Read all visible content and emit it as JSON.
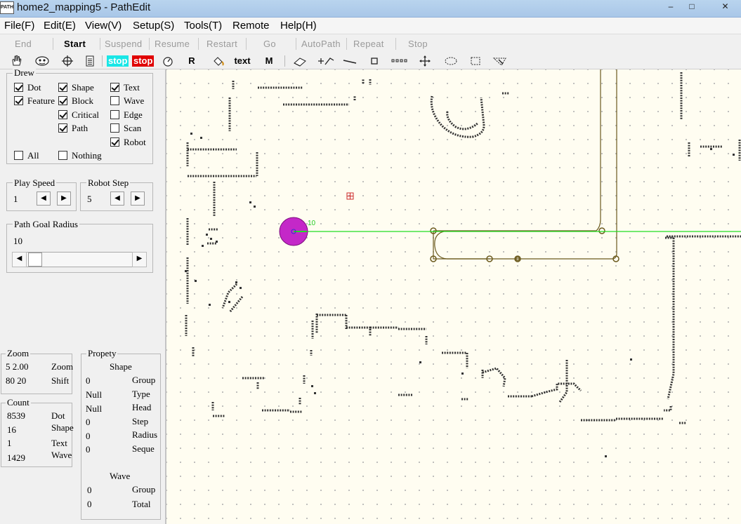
{
  "window": {
    "icon_text": "PATH",
    "title": "home2_mapping5 - PathEdit",
    "minimize": "–",
    "maximize": "□",
    "close": "✕"
  },
  "menu": {
    "items": [
      "File(F)",
      "Edit(E)",
      "View(V)",
      "Setup(S)",
      "Tools(T)",
      "Remote",
      "Help(H)"
    ]
  },
  "actions": {
    "items": [
      "End",
      "Start",
      "Suspend",
      "Resume",
      "Restart",
      "Go",
      "AutoPath",
      "Repeat",
      "Stop"
    ],
    "active": "Start"
  },
  "toolbar": {
    "icons": [
      "hand-icon",
      "eye-icon",
      "crosshair-icon",
      "document-icon"
    ],
    "stop_cyan": "stop",
    "stop_red": "stop",
    "r_label": "R",
    "text_label": "text",
    "m_label": "M",
    "tools": [
      "gauge-icon",
      "paint-icon",
      "eraser-icon",
      "add-point-icon",
      "line-icon",
      "square-icon",
      "dots-icon",
      "move-icon",
      "ellipse-icon",
      "select-rect-icon",
      "pointer-icon"
    ]
  },
  "drew": {
    "label": "Drew",
    "checks": [
      {
        "label": "Dot",
        "checked": true
      },
      {
        "label": "Feature",
        "checked": true
      },
      {
        "label": "Shape",
        "checked": true
      },
      {
        "label": "Block",
        "checked": true
      },
      {
        "label": "Critical",
        "checked": true
      },
      {
        "label": "Path",
        "checked": true
      },
      {
        "label": "Text",
        "checked": true
      },
      {
        "label": "Wave",
        "checked": false
      },
      {
        "label": "Edge",
        "checked": false
      },
      {
        "label": "Scan",
        "checked": false
      },
      {
        "label": "Robot",
        "checked": true
      },
      {
        "label": "All",
        "checked": false
      },
      {
        "label": "Nothing",
        "checked": false
      }
    ]
  },
  "play_speed": {
    "label": "Play Speed",
    "value": "1"
  },
  "robot_step": {
    "label": "Robot Step",
    "value": "5"
  },
  "path_goal_radius": {
    "label": "Path Goal Radius",
    "value": "10"
  },
  "zoom": {
    "label": "Zoom",
    "row1_value": "5 2.00",
    "row1_label": "Zoom",
    "row2_value": "80 20",
    "row2_label": "Shift"
  },
  "count": {
    "label": "Count",
    "rows": [
      {
        "value": "8539",
        "label": "Dot"
      },
      {
        "value": "16",
        "label": "Shape"
      },
      {
        "value": "1",
        "label": "Text"
      },
      {
        "value": "1429",
        "label": "Wave"
      }
    ]
  },
  "property": {
    "label": "Propety",
    "shape_heading": "Shape",
    "shape_rows": [
      {
        "value": "0",
        "label": "Group"
      },
      {
        "value": "Null",
        "label": "Type"
      },
      {
        "value": "Null",
        "label": "Head"
      },
      {
        "value": "0",
        "label": "Step"
      },
      {
        "value": "0",
        "label": "Radius"
      },
      {
        "value": "0",
        "label": "Seque"
      }
    ],
    "wave_heading": "Wave",
    "wave_rows": [
      {
        "value": "0",
        "label": "Group"
      },
      {
        "value": "0",
        "label": "Total"
      }
    ]
  },
  "map": {
    "robot_label": "10",
    "colors": {
      "background": "#fffdf1",
      "wall": "#333333",
      "path": "#6b5a1e",
      "robot": "#c428c8",
      "laser": "#22dd22"
    }
  }
}
